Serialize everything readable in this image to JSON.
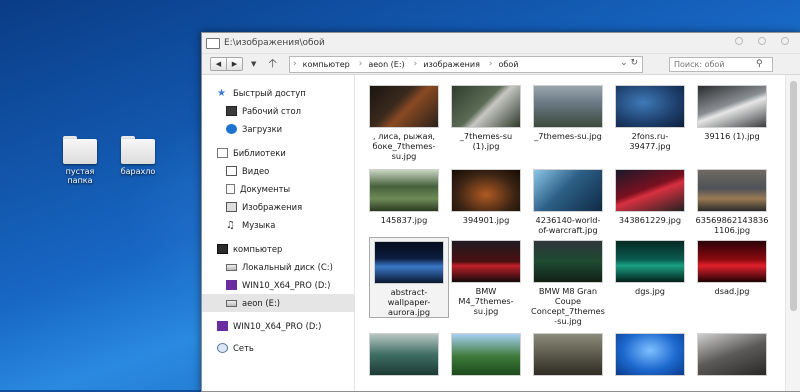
{
  "desktop": {
    "icons": [
      {
        "label": "пустая папка"
      },
      {
        "label": "барахло"
      }
    ]
  },
  "window": {
    "title": "E:\\изображения\\обой",
    "toolbar": {
      "back_icon": "back-arrow-icon",
      "forward_icon": "forward-arrow-icon",
      "breadcrumb": [
        "компьютер",
        "aeon (E:)",
        "изображения",
        "обой"
      ],
      "search_placeholder": "Поиск: обой"
    },
    "nav": {
      "quick_access": "Быстрый доступ",
      "desktop": "Рабочий стол",
      "downloads": "Загрузки",
      "libraries": "Библиотеки",
      "video": "Видео",
      "documents": "Документы",
      "images": "Изображения",
      "music": "Музыка",
      "computer": "компьютер",
      "local_disk": "Локальный диск (C:)",
      "win10_d": "WIN10_X64_PRO (D:)",
      "aeon_e": "aeon (E:)",
      "win10_d2": "WIN10_X64_PRO (D:)",
      "network": "Сеть"
    },
    "files": [
      {
        "name": ", лиса, рыжая, боке_7themes-su.jpg",
        "color": "#3a2a1e"
      },
      {
        "name": "_7themes-su (1).jpg",
        "color": "#5b6b55"
      },
      {
        "name": "_7themes-su.jpg",
        "color": "#6c7a86"
      },
      {
        "name": "2fons.ru-39477.jpg",
        "color": "#1d3e6b"
      },
      {
        "name": "39116 (1).jpg",
        "color": "#8a8e92"
      },
      {
        "name": "145837.jpg",
        "color": "#46603c"
      },
      {
        "name": "394901.jpg",
        "color": "#3b2414"
      },
      {
        "name": "4236140-world-of-warcraft.jpg",
        "color": "#2d5f86"
      },
      {
        "name": "343861229.jpg",
        "color": "#7a1020"
      },
      {
        "name": "635698621438361106.jpg",
        "color": "#4e5257"
      },
      {
        "name": "abstract-wallpaper-aurora.jpg",
        "color": "#0b1d3f"
      },
      {
        "name": "BMW M4_7themes-su.jpg",
        "color": "#4a1010"
      },
      {
        "name": "BMW M8 Gran Coupe Concept_7themes-su.jpg",
        "color": "#1f4a32"
      },
      {
        "name": "dgs.jpg",
        "color": "#0a5a4e"
      },
      {
        "name": "dsad.jpg",
        "color": "#8a0a10"
      },
      {
        "name": "",
        "color": "#3e6e64"
      },
      {
        "name": "",
        "color": "#3d7a3a"
      },
      {
        "name": "",
        "color": "#5c5a4c"
      },
      {
        "name": "",
        "color": "#1d6ad0"
      },
      {
        "name": "",
        "color": "#5c5a58"
      }
    ]
  }
}
